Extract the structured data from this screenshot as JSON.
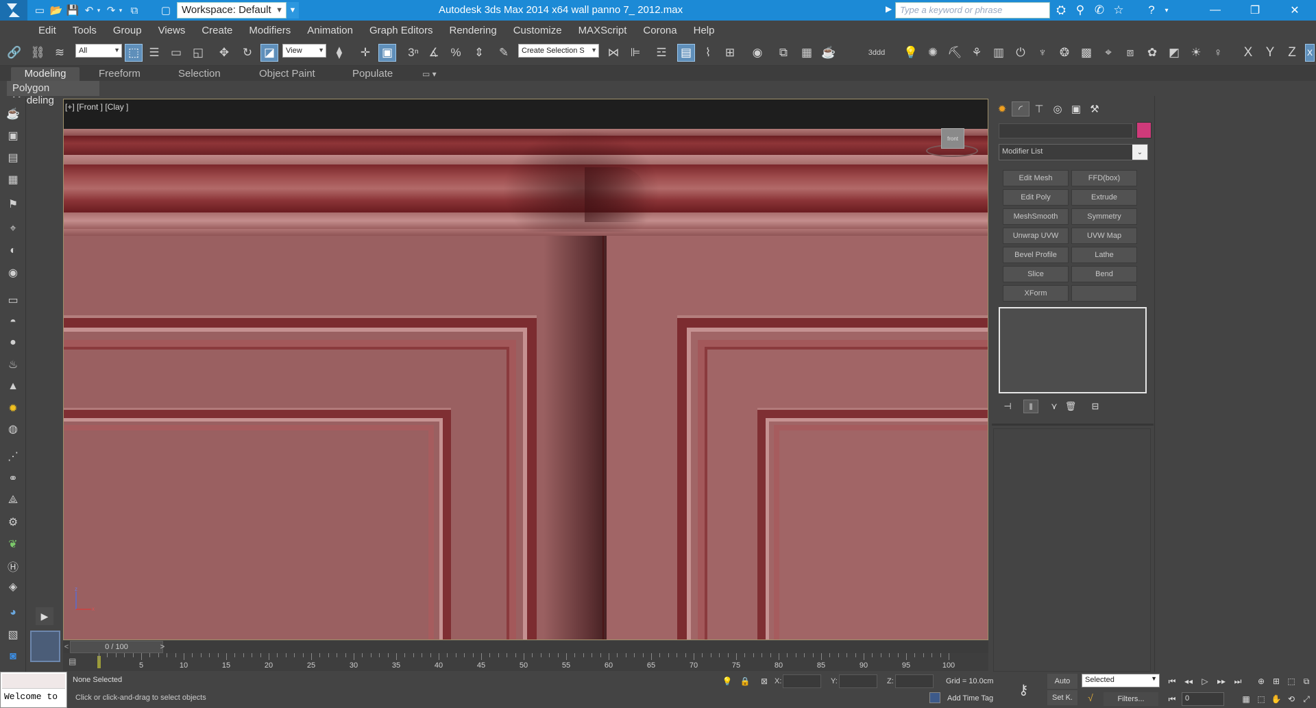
{
  "window": {
    "title": "Autodesk 3ds Max  2014 x64      wall panno 7_ 2012.max",
    "workspace": "Workspace: Default",
    "search_placeholder": "Type a keyword or phrase"
  },
  "menu": [
    "Edit",
    "Tools",
    "Group",
    "Views",
    "Create",
    "Modifiers",
    "Animation",
    "Graph Editors",
    "Rendering",
    "Customize",
    "MAXScript",
    "Corona",
    "Help"
  ],
  "toolbar": {
    "selection_filter": "All",
    "ref_coord": "View",
    "named_selection": "Create Selection S",
    "label_3ddd": "3ddd",
    "axis_x": "X",
    "axis_y": "Y",
    "axis_z": "Z"
  },
  "ribbon": {
    "tabs": [
      "Modeling",
      "Freeform",
      "Selection",
      "Object Paint",
      "Populate"
    ],
    "active_tab": "Modeling",
    "subpanel": "Polygon Modeling"
  },
  "viewport": {
    "label": "[+] [Front ] [Clay ]",
    "viewcube_label": "front",
    "wall_color": "#9a6061"
  },
  "command_panel": {
    "modifier_list": "Modifier List",
    "object_color": "#cf3a7a",
    "modifier_buttons": [
      "Edit Mesh",
      "FFD(box)",
      "Edit Poly",
      "Extrude",
      "MeshSmooth",
      "Symmetry",
      "Unwrap UVW",
      "UVW Map",
      "Bevel Profile",
      "Lathe",
      "Slice",
      "Bend",
      "XForm",
      ""
    ]
  },
  "timeline": {
    "slider": "0 / 100",
    "left_arrow": "<",
    "right_arrow": ">",
    "labels": [
      "5",
      "10",
      "15",
      "20",
      "25",
      "30",
      "35",
      "40",
      "45",
      "50",
      "55",
      "60",
      "65",
      "70",
      "75",
      "80",
      "85",
      "90",
      "95",
      "100"
    ]
  },
  "status": {
    "selection": "None Selected",
    "prompt": "Click or click-and-drag to select objects",
    "maxscript": "Welcome to",
    "x_label": "X:",
    "y_label": "Y:",
    "z_label": "Z:",
    "grid": "Grid = 10.0cm",
    "add_time_tag": "Add Time Tag",
    "auto_key": "Auto",
    "set_key": "Set K.",
    "key_filter": "Selected",
    "filters": "Filters...",
    "current_frame": "0"
  }
}
